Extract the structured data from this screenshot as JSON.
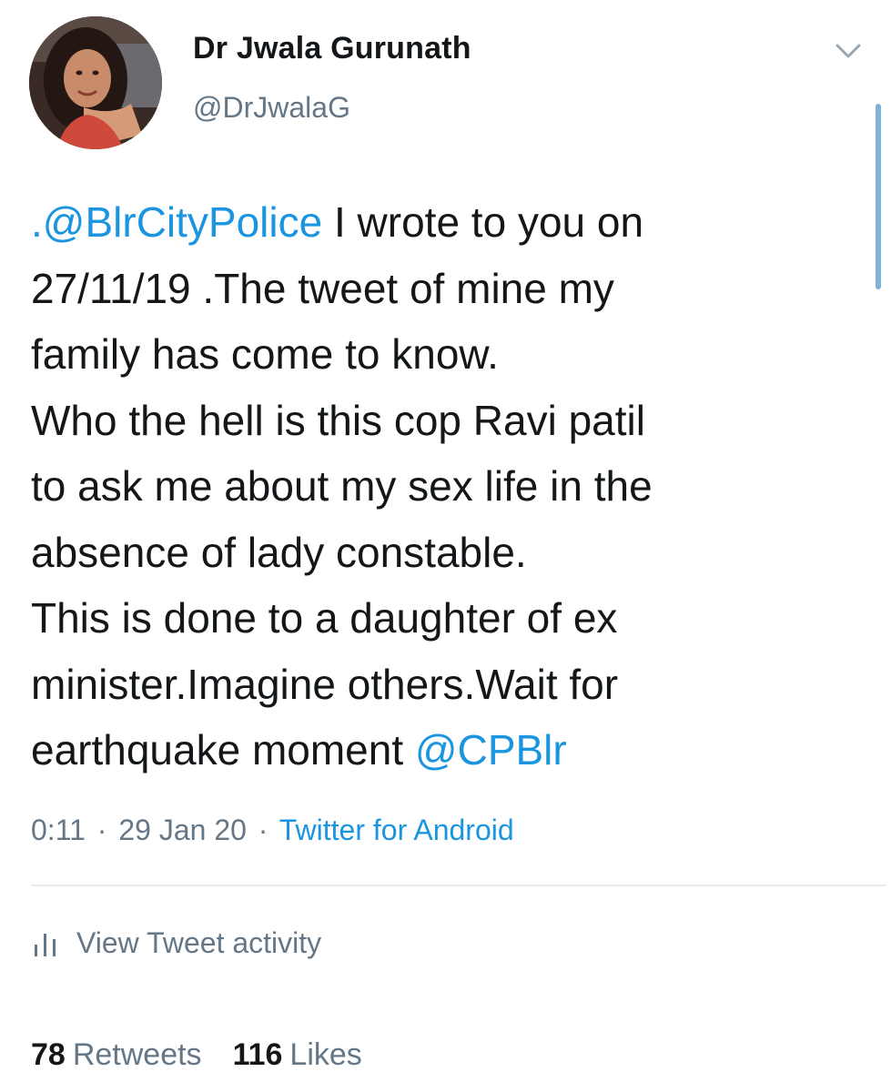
{
  "author": {
    "display_name": "Dr Jwala Gurunath",
    "handle": "@DrJwalaG",
    "avatar_icon": "profile-photo"
  },
  "header": {
    "menu_icon": "chevron-down-icon"
  },
  "tweet": {
    "lines": [
      {
        "mention": ".@BlrCityPolice",
        "text": " I wrote to you on"
      },
      {
        "text": "27/11/19 .The tweet of mine my"
      },
      {
        "text": "family has come to know."
      },
      {
        "text": "Who the hell is this cop Ravi patil"
      },
      {
        "text": "to ask me about my sex life in the"
      },
      {
        "text": "absence of lady constable."
      },
      {
        "text": "This is done to a daughter of ex"
      },
      {
        "text": "minister.Imagine others.Wait for"
      },
      {
        "text": "earthquake moment ",
        "mention": "@CPBlr"
      }
    ],
    "time": "0:11",
    "separator": "·",
    "date": "29 Jan 20",
    "source": "Twitter for Android"
  },
  "activity": {
    "icon": "bar-chart-icon",
    "label": "View Tweet activity"
  },
  "stats": {
    "retweets_count": "78",
    "retweets_label": "Retweets",
    "likes_count": "116",
    "likes_label": "Likes"
  },
  "colors": {
    "link": "#1b95e0",
    "secondary_text": "#657786",
    "primary_text": "#14171a"
  }
}
